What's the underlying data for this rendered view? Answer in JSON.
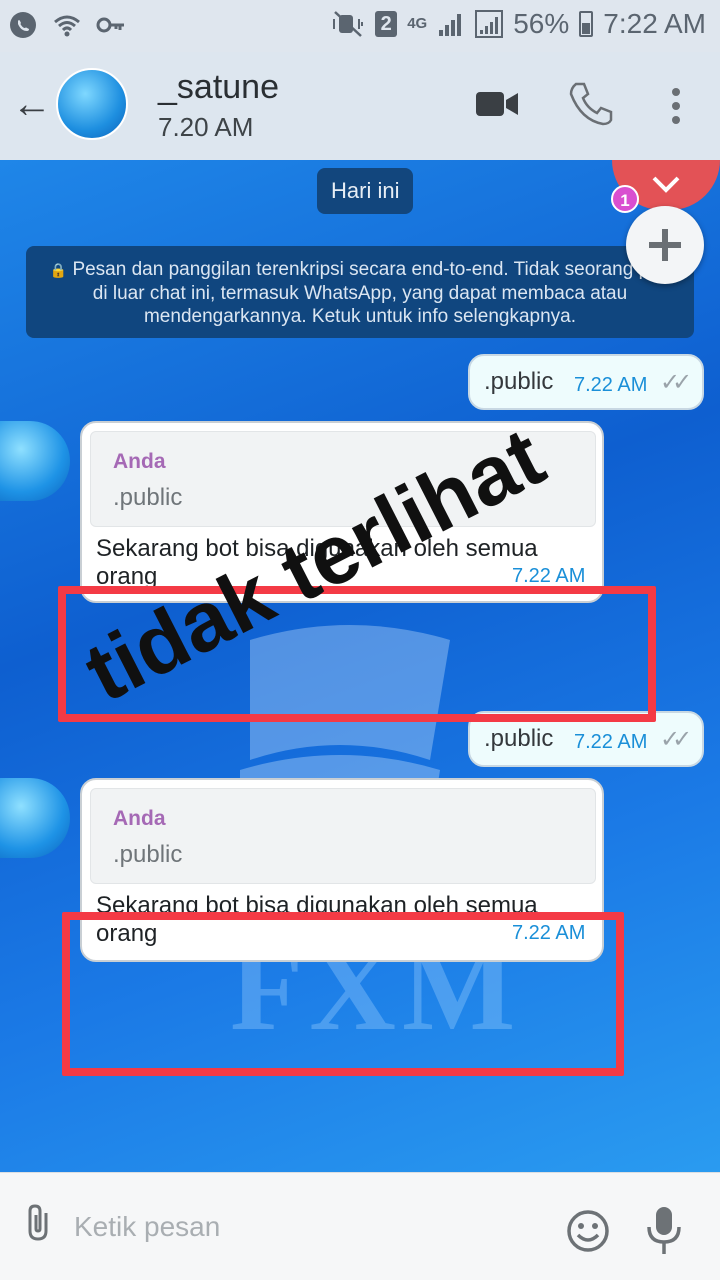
{
  "status_bar": {
    "network": "4G",
    "sim_badge": "2",
    "battery": "56%",
    "time": "7:22 AM"
  },
  "header": {
    "contact_name": "_satune",
    "last_seen": "7.20 AM"
  },
  "chat": {
    "date_chip": "Hari ini",
    "encryption_notice": "Pesan dan panggilan terenkripsi secara end-to-end. Tidak seorang pun di luar chat ini, termasuk WhatsApp, yang dapat membaca atau mendengarkannya. Ketuk untuk info selengkapnya.",
    "unread_count": "1",
    "wallpaper_text": "FXM",
    "messages": [
      {
        "type": "outgoing",
        "text": ".public",
        "time": "7.22 AM"
      },
      {
        "type": "incoming",
        "quote_author": "Anda",
        "quote_text": ".public",
        "text": "Sekarang bot bisa digunakan oleh semua orang",
        "time": "7.22 AM"
      },
      {
        "type": "outgoing",
        "text": ".public",
        "time": "7.22 AM"
      },
      {
        "type": "incoming",
        "quote_author": "Anda",
        "quote_text": ".public",
        "text": "Sekarang bot bisa digunakan oleh semua orang",
        "time": "7.22 AM"
      }
    ],
    "annotation": "tidak terlihat"
  },
  "input": {
    "placeholder": "Ketik pesan"
  },
  "colors": {
    "header_bg": "#dde6ef",
    "chat_bg": "#1b6fdc",
    "outgoing_bubble": "#eefcfd",
    "incoming_bubble": "#ffffff",
    "timestamp": "#1a8fd8",
    "annotation_box": "#f43a45",
    "quote_author": "#a569b5"
  },
  "icons": [
    "whatsapp-icon",
    "wifi-icon",
    "key-icon",
    "mute-icon",
    "signal-icon",
    "back-arrow-icon",
    "video-call-icon",
    "phone-icon",
    "more-vert-icon",
    "chevron-down-icon",
    "plus-icon",
    "double-check-icon",
    "attach-icon",
    "emoji-icon",
    "mic-icon"
  ]
}
